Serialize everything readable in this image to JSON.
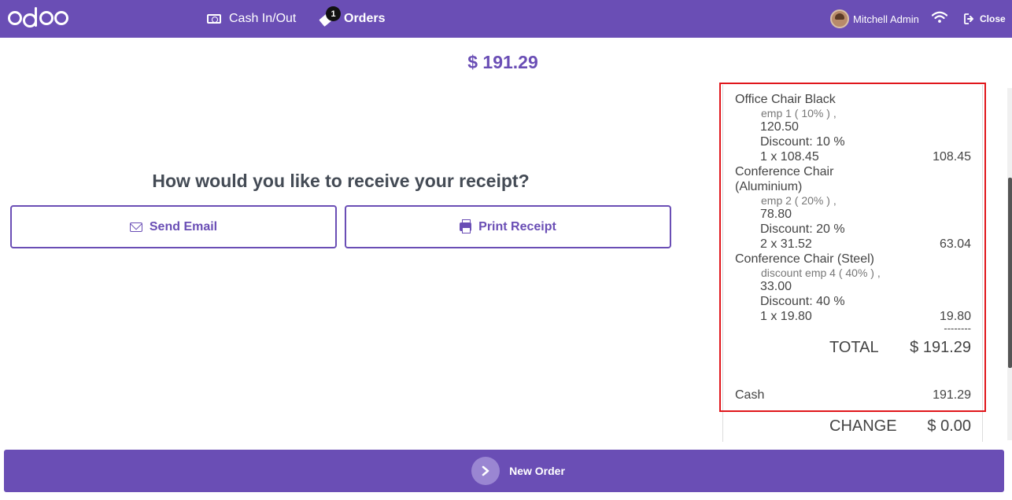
{
  "header": {
    "logo_text": "odoo",
    "cash_label": "Cash In/Out",
    "orders_label": "Orders",
    "orders_badge": "1",
    "user_name": "Mitchell Admin",
    "close_label": "Close"
  },
  "main": {
    "amount": "$ 191.29",
    "question": "How would you like to receive your receipt?",
    "send_email_label": "Send Email",
    "print_receipt_label": "Print Receipt"
  },
  "receipt": {
    "line1": {
      "name": "Office Chair Black",
      "pricelist": "emp 1 ( 10% ) ,",
      "orig_price": "120.50",
      "discount": "Discount: 10 %",
      "qty_price": "1 x 108.45",
      "total": "108.45"
    },
    "line2": {
      "name_a": "Conference Chair",
      "name_b": "(Aluminium)",
      "pricelist": "emp 2 ( 20% ) ,",
      "orig_price": "78.80",
      "discount": "Discount: 20 %",
      "qty_price": "2 x 31.52",
      "total": "63.04"
    },
    "line3": {
      "name": "Conference Chair (Steel)",
      "pricelist": "discount emp 4 ( 40% ) ,",
      "orig_price": "33.00",
      "discount": "Discount: 40 %",
      "qty_price": "1 x 19.80",
      "total": "19.80"
    },
    "separator": "--------",
    "total_label": "TOTAL",
    "total_value": "$ 191.29",
    "payment_label": "Cash",
    "payment_value": "191.29",
    "change_label": "CHANGE",
    "change_value": "$ 0.00"
  },
  "footer": {
    "new_order_label": "New Order",
    "new_order_icon": "chevron-right-icon"
  },
  "colors": {
    "brand": "#6a4eb5",
    "highlight": "#e0161b"
  }
}
